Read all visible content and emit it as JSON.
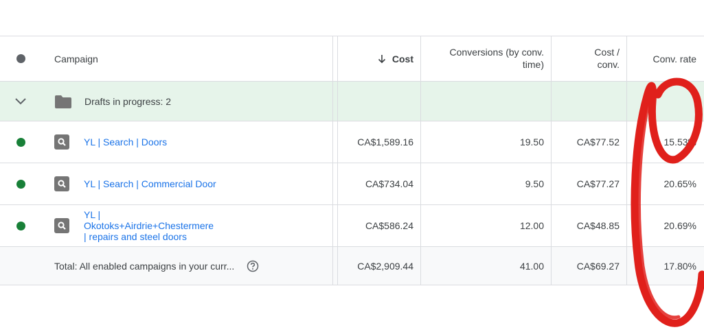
{
  "header": {
    "campaign": "Campaign",
    "cost": "Cost",
    "conversions": [
      "Conversions (by conv.",
      "time)"
    ],
    "cost_per_conv": [
      "Cost /",
      "conv."
    ],
    "conv_rate": "Conv. rate"
  },
  "drafts": {
    "label": "Drafts in progress: 2"
  },
  "rows": [
    {
      "status": "enabled",
      "name_lines": [
        "YL | Search | Doors"
      ],
      "cost": "CA$1,589.16",
      "conversions": "19.50",
      "cost_per_conv": "CA$77.52",
      "conv_rate": "15.53%"
    },
    {
      "status": "enabled",
      "name_lines": [
        "YL | Search | Commercial Door"
      ],
      "cost": "CA$734.04",
      "conversions": "9.50",
      "cost_per_conv": "CA$77.27",
      "conv_rate": "20.65%"
    },
    {
      "status": "enabled",
      "name_lines": [
        "YL |",
        "Okotoks+Airdrie+Chestermere",
        "| repairs and steel doors"
      ],
      "cost": "CA$586.24",
      "conversions": "12.00",
      "cost_per_conv": "CA$48.85",
      "conv_rate": "20.69%"
    }
  ],
  "total": {
    "label": "Total: All enabled campaigns in your curr...",
    "cost": "CA$2,909.44",
    "conversions": "41.00",
    "cost_per_conv": "CA$69.27",
    "conv_rate": "17.80%"
  },
  "icons": {
    "status_header": "status-dot-icon",
    "expand": "chevron-down-icon",
    "folder": "folder-icon",
    "campaign": "search-campaign-icon",
    "sort": "arrow-down-icon",
    "help": "help-circle-icon"
  },
  "colors": {
    "link": "#1a73e8",
    "enabled": "#188038",
    "drafts_bg": "#e6f4ea",
    "annotation": "#e0201b"
  }
}
